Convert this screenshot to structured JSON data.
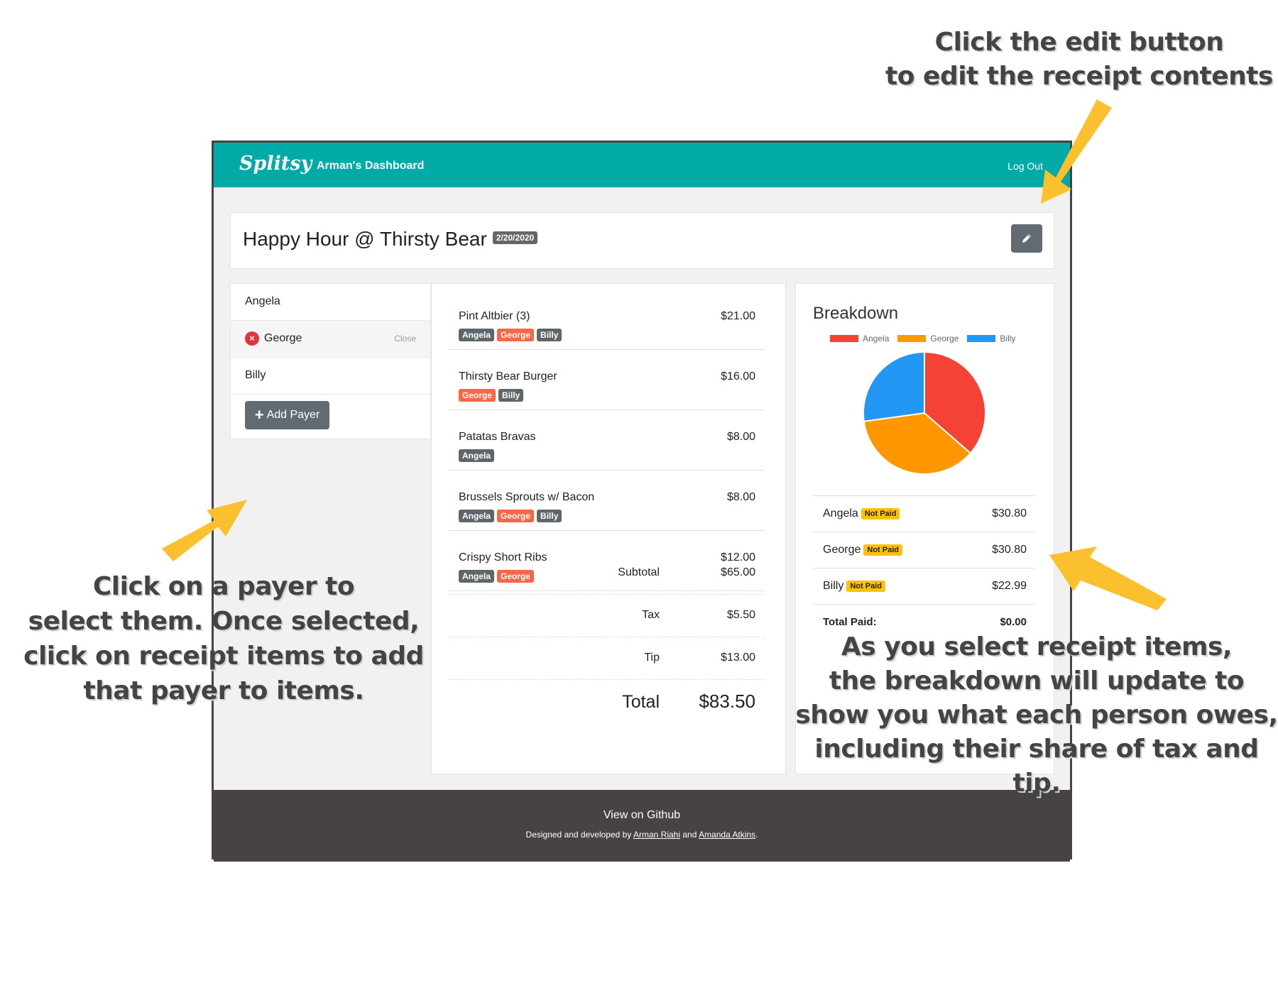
{
  "navbar": {
    "brand": "Splitsy",
    "dashboard": "Arman's Dashboard",
    "logout": "Log Out"
  },
  "receipt": {
    "title": "Happy Hour @ Thirsty Bear",
    "date": "2/20/2020",
    "edit_icon": "pencil-icon"
  },
  "payers": {
    "items": [
      {
        "name": "Angela"
      },
      {
        "name": "George",
        "close_label": "Close"
      },
      {
        "name": "Billy"
      }
    ],
    "remove_icon": "×",
    "add_label": "Add Payer",
    "add_icon": "+"
  },
  "items": [
    {
      "name": "Pint Altbier (3)",
      "price": "$21.00",
      "tags": [
        "Angela",
        "George",
        "Billy"
      ]
    },
    {
      "name": "Thirsty Bear Burger",
      "price": "$16.00",
      "tags": [
        "George",
        "Billy"
      ]
    },
    {
      "name": "Patatas Bravas",
      "price": "$8.00",
      "tags": [
        "Angela"
      ]
    },
    {
      "name": "Brussels Sprouts w/ Bacon",
      "price": "$8.00",
      "tags": [
        "Angela",
        "George",
        "Billy"
      ]
    },
    {
      "name": "Crispy Short Ribs",
      "price": "$12.00",
      "tags": [
        "Angela",
        "George"
      ]
    }
  ],
  "summary": {
    "subtotal_label": "Subtotal",
    "subtotal": "$65.00",
    "tax_label": "Tax",
    "tax": "$5.50",
    "tip_label": "Tip",
    "tip": "$13.00",
    "total_label": "Total",
    "total": "$83.50"
  },
  "breakdown": {
    "title": "Breakdown",
    "rows": [
      {
        "name": "Angela",
        "status": "Not Paid",
        "amount": "$30.80"
      },
      {
        "name": "George",
        "status": "Not Paid",
        "amount": "$30.80"
      },
      {
        "name": "Billy",
        "status": "Not Paid",
        "amount": "$22.99"
      }
    ],
    "total_label": "Total Paid:",
    "total": "$0.00"
  },
  "chart_data": {
    "type": "pie",
    "labels": [
      "Angela",
      "George",
      "Billy"
    ],
    "values": [
      30.8,
      30.8,
      22.99
    ],
    "colors": [
      "#f44336",
      "#ff9800",
      "#2196f3"
    ],
    "legend": "top"
  },
  "footer": {
    "link": "View on Github",
    "credits_prefix": "Designed and developed by",
    "author1": "Arman Riahi",
    "and": "and",
    "author2": "Amanda Atkins",
    "suffix": "."
  },
  "annotations": {
    "edit_line1": "Click the edit button",
    "edit_line2": "to edit the receipt contents",
    "payer_line1": "Click on a payer to",
    "payer_line2": "select them. Once selected,",
    "payer_line3": "click on receipt items to add",
    "payer_line4": "that payer to items.",
    "breakdown_line1": "As you select receipt items,",
    "breakdown_line2": "the breakdown will update to",
    "breakdown_line3": "show you what each person owes,",
    "breakdown_line4": "including their share of tax and tip.",
    "arrow_color": "#fbc02d"
  }
}
